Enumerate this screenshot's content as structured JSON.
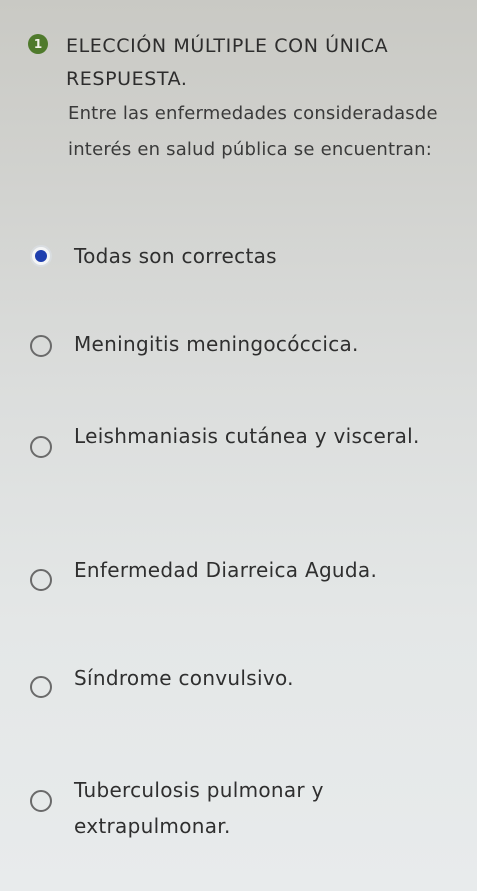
{
  "question": {
    "number": "1",
    "title": "Elección múltiple con única respuesta.",
    "body": "Entre las enfermedades consideradasde interés en salud pública se encuentran:",
    "accent_color": "#4f7a2c"
  },
  "options": [
    {
      "label": "Todas son correctas",
      "selected": true
    },
    {
      "label": "Meningitis meningocóccica.",
      "selected": false
    },
    {
      "label": "Leishmaniasis cutánea y visceral.",
      "selected": false
    },
    {
      "label": "Enfermedad Diarreica Aguda.",
      "selected": false
    },
    {
      "label": "Síndrome convulsivo.",
      "selected": false
    },
    {
      "label": "Tuberculosis pulmonar y extrapulmonar.",
      "selected": false
    }
  ],
  "colors": {
    "selected_radio": "#1f3fae"
  }
}
